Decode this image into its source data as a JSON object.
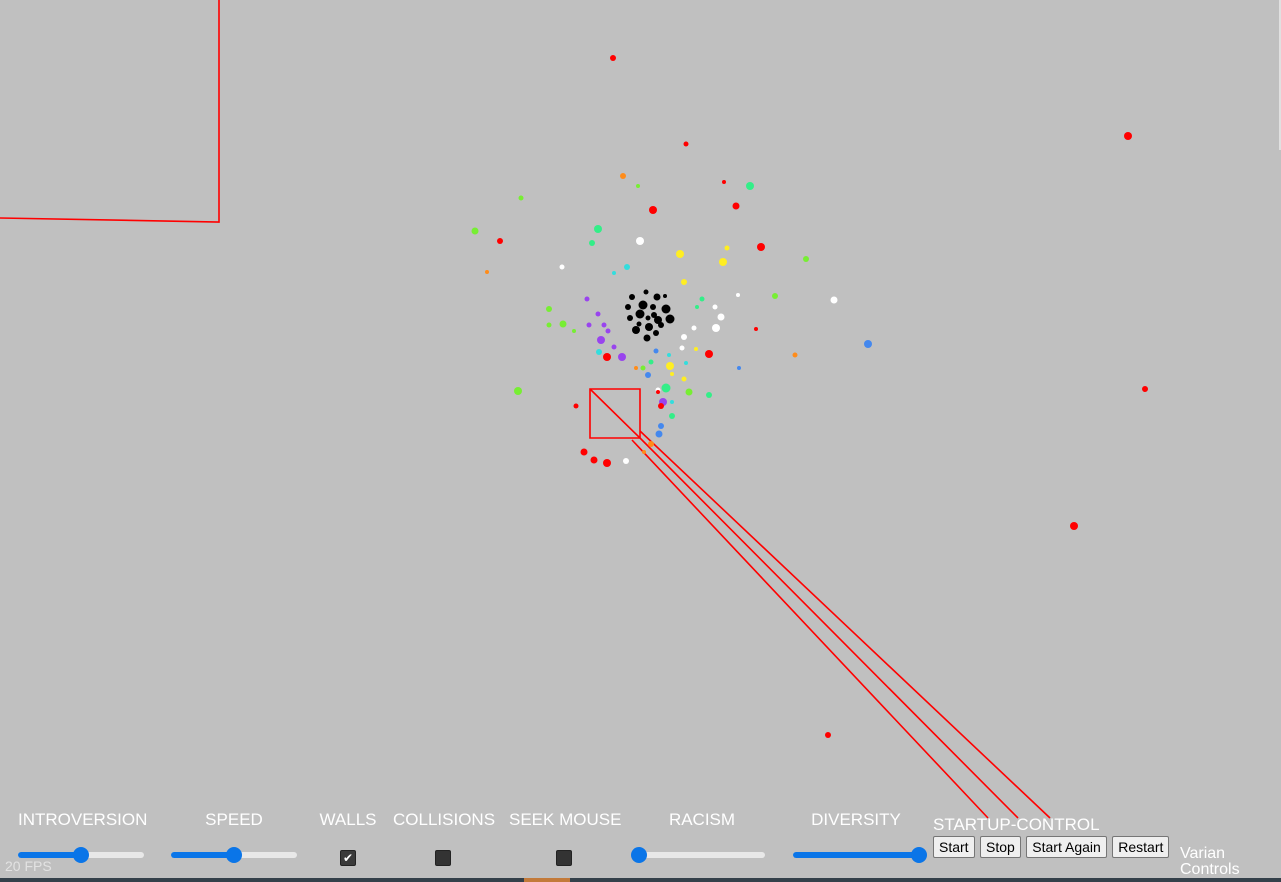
{
  "controls": [
    {
      "label": "INTROVERSION",
      "kind": "slider",
      "value": 0.5
    },
    {
      "label": "SPEED",
      "kind": "slider",
      "value": 0.5
    },
    {
      "label": "WALLS",
      "kind": "checkbox",
      "checked": true
    },
    {
      "label": "COLLISIONS",
      "kind": "checkbox",
      "checked": false
    },
    {
      "label": "SEEK MOUSE",
      "kind": "checkbox",
      "checked": false
    },
    {
      "label": "RACISM",
      "kind": "slider",
      "value": 0.0
    },
    {
      "label": "DIVERSITY",
      "kind": "slider",
      "value": 1.0
    }
  ],
  "startup": {
    "label": "STARTUP-CONTROL",
    "buttons": [
      "Start",
      "Stop",
      "Start Again",
      "Restart"
    ]
  },
  "varian_label": "Varian Controls",
  "fps_label": "20 FPS",
  "colors": {
    "background": "#c0c0c0",
    "wall": "#ff0000",
    "slider_accent": "#0a75e8",
    "agents": [
      "#ff0000",
      "#ff8c1a",
      "#ffee22",
      "#77ee33",
      "#33ee88",
      "#33dddd",
      "#4488ee",
      "#9944ee",
      "#ffffff",
      "#000000"
    ]
  }
}
